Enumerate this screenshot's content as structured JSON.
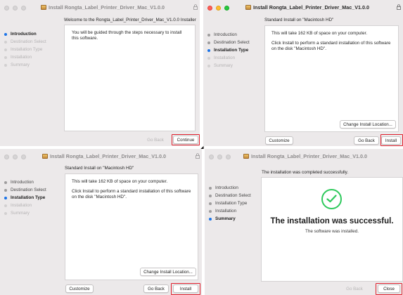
{
  "windows": [
    {
      "title": "Install Rongta_Label_Printer_Driver_Mac_V1.0.0",
      "heading": "Welcome to the Rongta_Label_Printer_Driver_Mac_V1.0.0 Installer",
      "steps": [
        "Introduction",
        "Destination Select",
        "Installation Type",
        "Installation",
        "Summary"
      ],
      "current_step": "Introduction",
      "body": [
        "You will be guided through the steps necessary to install this software."
      ],
      "buttons": {
        "go_back": "Go Back",
        "continue": "Continue"
      }
    },
    {
      "title": "Install Rongta_Label_Printer_Driver_Mac_V1.0.0",
      "heading": "Standard Install on \"Macintosh HD\"",
      "steps": [
        "Introduction",
        "Destination Select",
        "Installation Type",
        "Installation",
        "Summary"
      ],
      "current_step": "Installation Type",
      "body": [
        "This will take 162 KB of space on your computer.",
        "Click Install to perform a standard installation of this software on the disk \"Macintosh HD\"."
      ],
      "buttons": {
        "change_location": "Change Install Location...",
        "customize": "Customize",
        "go_back": "Go Back",
        "install": "Install"
      }
    },
    {
      "title": "Install Rongta_Label_Printer_Driver_Mac_V1.0.0",
      "heading": "Standard Install on \"Macintosh HD\"",
      "steps": [
        "Introduction",
        "Destination Select",
        "Installation Type",
        "Installation",
        "Summary"
      ],
      "current_step": "Installation Type",
      "body": [
        "This will take 162 KB of space on your computer.",
        "Click Install to perform a standard installation of this software on the disk \"Macintosh HD\"."
      ],
      "buttons": {
        "change_location": "Change Install Location...",
        "customize": "Customize",
        "go_back": "Go Back",
        "install": "Install"
      }
    },
    {
      "title": "Install Rongta_Label_Printer_Driver_Mac_V1.0.0",
      "heading": "The installation was completed successfully.",
      "steps": [
        "Introduction",
        "Destination Select",
        "Installation Type",
        "Installation",
        "Summary"
      ],
      "current_step": "Summary",
      "success_title": "The installation was successful.",
      "success_sub": "The software was installed.",
      "buttons": {
        "go_back": "Go Back",
        "close": "Close"
      }
    }
  ],
  "colors": {
    "highlight": "#e0202d",
    "current_step_dot": "#1a73e8",
    "success": "#2ec95c"
  },
  "icons": [
    "package-icon",
    "lock-icon",
    "checkmark-icon"
  ]
}
